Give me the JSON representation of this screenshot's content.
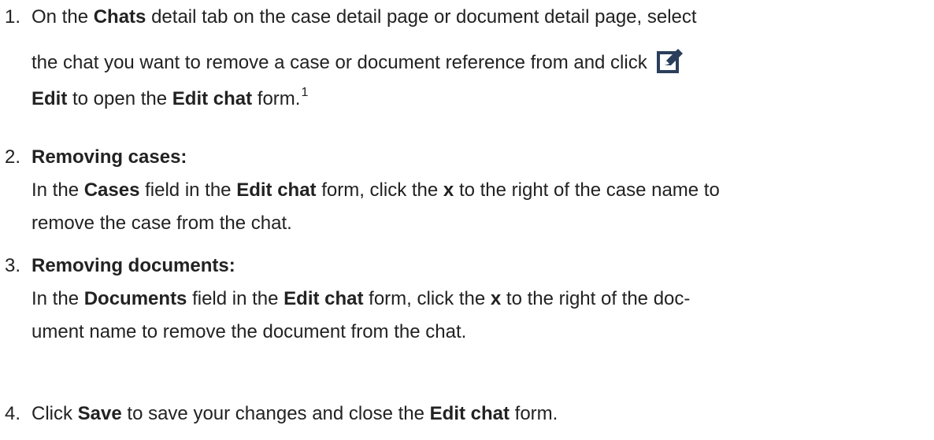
{
  "steps": [
    {
      "number": "1.",
      "line1": {
        "t1": "On the ",
        "b1": "Chats",
        "t2": " detail tab on the case detail page or document detail page, select"
      },
      "line2": {
        "t1": "the chat you want to remove a case or document reference from and click"
      },
      "line3": {
        "b1": "Edit",
        "t1": " to open the ",
        "b2": "Edit chat",
        "t2": " form.",
        "sup": "1"
      },
      "icon": "edit-icon"
    },
    {
      "number": "2.",
      "heading": "Removing cases:",
      "line1": {
        "t1": "In the ",
        "b1": "Cases",
        "t2": " field in the ",
        "b2": "Edit chat",
        "t3": " form, click the ",
        "b3": "x",
        "t4": " to the right of the case name to"
      },
      "line2": {
        "t1": "remove the case from the chat."
      }
    },
    {
      "number": "3.",
      "heading": "Removing documents:",
      "line1": {
        "t1": "In the ",
        "b1": "Documents",
        "t2": " field in the ",
        "b2": "Edit chat",
        "t3": " form, click the ",
        "b3": "x",
        "t4": " to the right of the doc-"
      },
      "line2": {
        "t1": "ument name to remove the document from the chat."
      }
    },
    {
      "number": "4.",
      "line1": {
        "t1": "Click ",
        "b1": "Save",
        "t2": " to save your changes and close the ",
        "b2": "Edit chat",
        "t3": " form."
      }
    }
  ],
  "colors": {
    "text": "#222222",
    "icon": "#2b3f5c"
  }
}
